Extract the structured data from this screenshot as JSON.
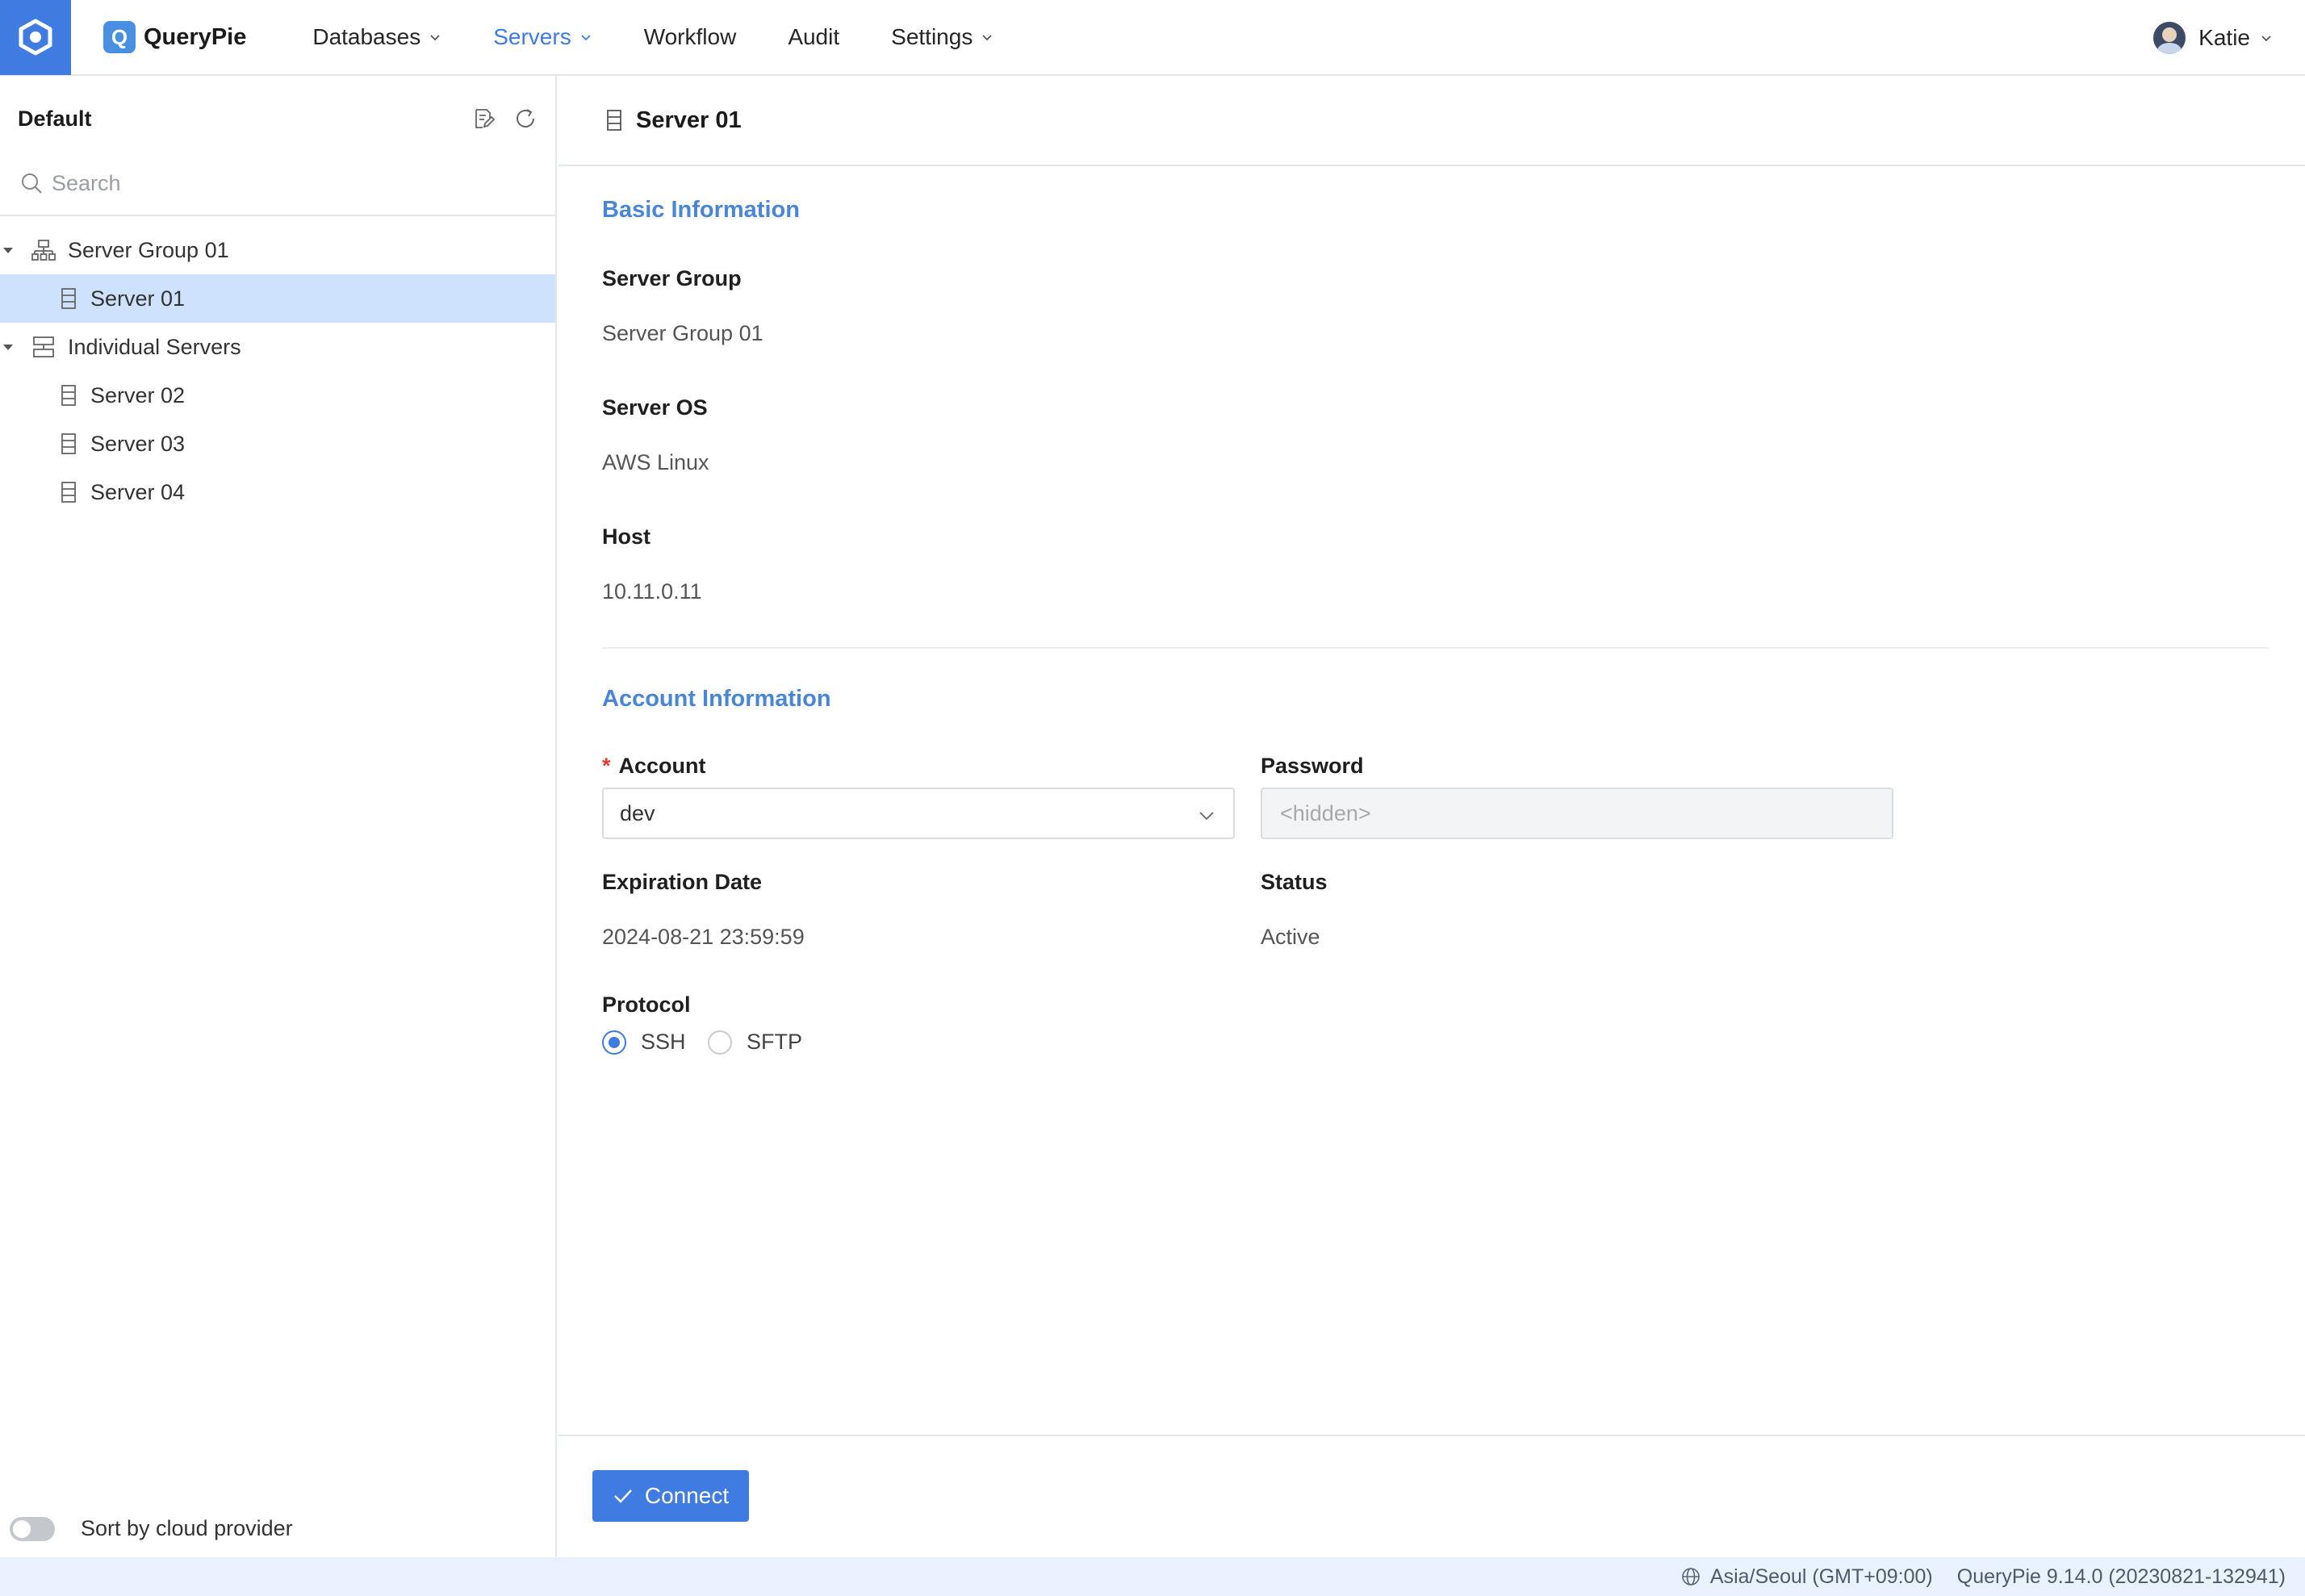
{
  "app": {
    "name": "QueryPie",
    "logo_letter": "Q"
  },
  "nav": {
    "items": [
      {
        "label": "Databases",
        "has_dropdown": true,
        "active": false
      },
      {
        "label": "Servers",
        "has_dropdown": true,
        "active": true
      },
      {
        "label": "Workflow",
        "has_dropdown": false,
        "active": false
      },
      {
        "label": "Audit",
        "has_dropdown": false,
        "active": false
      },
      {
        "label": "Settings",
        "has_dropdown": true,
        "active": false
      }
    ],
    "user": {
      "name": "Katie"
    }
  },
  "sidebar": {
    "title": "Default",
    "search": {
      "placeholder": "Search",
      "value": ""
    },
    "tree": {
      "groups": [
        {
          "label": "Server Group 01",
          "expanded": true,
          "children": [
            {
              "label": "Server 01",
              "selected": true
            }
          ]
        },
        {
          "label": "Individual Servers",
          "expanded": true,
          "children": [
            {
              "label": "Server 02",
              "selected": false
            },
            {
              "label": "Server 03",
              "selected": false
            },
            {
              "label": "Server 04",
              "selected": false
            }
          ]
        }
      ]
    },
    "sort_toggle": {
      "label": "Sort by cloud provider",
      "on": false
    }
  },
  "main": {
    "title": "Server 01",
    "basic": {
      "title": "Basic Information",
      "server_group": {
        "label": "Server Group",
        "value": "Server Group 01"
      },
      "server_os": {
        "label": "Server OS",
        "value": "AWS Linux"
      },
      "host": {
        "label": "Host",
        "value": "10.11.0.11"
      }
    },
    "account": {
      "title": "Account Information",
      "account": {
        "label": "Account",
        "required_mark": "*",
        "value": "dev"
      },
      "password": {
        "label": "Password",
        "placeholder": "<hidden>"
      },
      "expiration": {
        "label": "Expiration Date",
        "value": "2024-08-21 23:59:59"
      },
      "status": {
        "label": "Status",
        "value": "Active"
      },
      "protocol": {
        "label": "Protocol",
        "options": [
          "SSH",
          "SFTP"
        ],
        "selected": "SSH"
      }
    },
    "connect_label": "Connect"
  },
  "statusbar": {
    "timezone": "Asia/Seoul (GMT+09:00)",
    "version": "QueryPie 9.14.0 (20230821-132941)"
  },
  "colors": {
    "accent": "#3f7be0",
    "selected_row": "#cfe2fd",
    "statusbar_bg": "#e8f1fd"
  }
}
